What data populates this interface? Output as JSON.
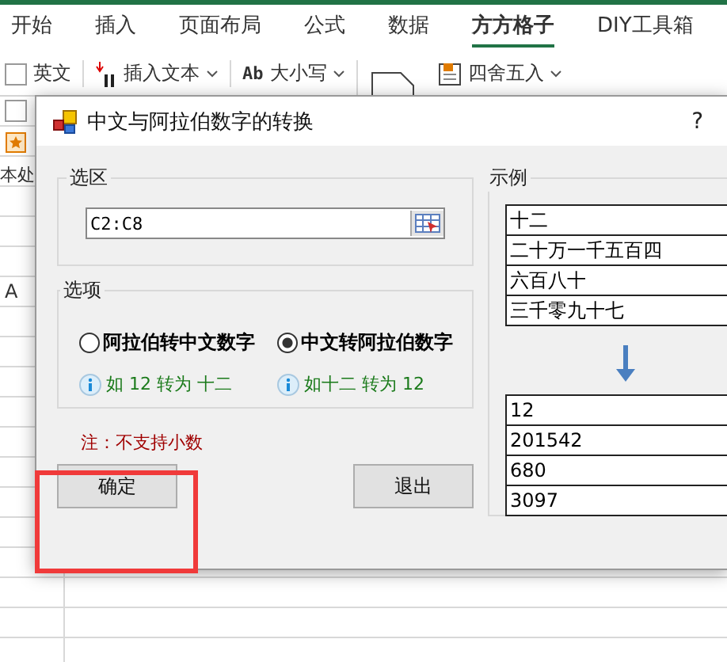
{
  "ribbon": {
    "tabs": [
      {
        "label": "开始",
        "selected": false
      },
      {
        "label": "插入",
        "selected": false
      },
      {
        "label": "页面布局",
        "selected": false
      },
      {
        "label": "公式",
        "selected": false
      },
      {
        "label": "数据",
        "selected": false
      },
      {
        "label": "方方格子",
        "selected": true
      },
      {
        "label": "DIY工具箱",
        "selected": false
      }
    ],
    "tools": [
      {
        "kind": "checkbox",
        "label": "英文",
        "checked": false
      },
      {
        "kind": "insert",
        "label": "插入文本"
      },
      {
        "kind": "case",
        "badge": "Ab",
        "label": "大小写"
      },
      {
        "kind": "round",
        "label": "四舍五入"
      }
    ]
  },
  "sheet": {
    "checkbox_checked": false,
    "side_text": "本处",
    "column_header": "A"
  },
  "dialog": {
    "title": "中文与阿拉伯数字的转换",
    "help": "?",
    "selection": {
      "title": "选区",
      "value": "C2:C8"
    },
    "options": {
      "title": "选项",
      "radios": [
        {
          "label": "阿拉伯转中文数字",
          "selected": false,
          "hint": "如 12 转为 十二"
        },
        {
          "label": "中文转阿拉伯数字",
          "selected": true,
          "hint": "如十二 转为 12"
        }
      ]
    },
    "note": "注：不支持小数",
    "example": {
      "title": "示例",
      "source": [
        "十二",
        "二十万一千五百四",
        "六百八十",
        "三千零九十七"
      ],
      "result": [
        "12",
        "201542",
        "680",
        "3097"
      ]
    },
    "buttons": [
      "确定",
      "退出"
    ]
  }
}
